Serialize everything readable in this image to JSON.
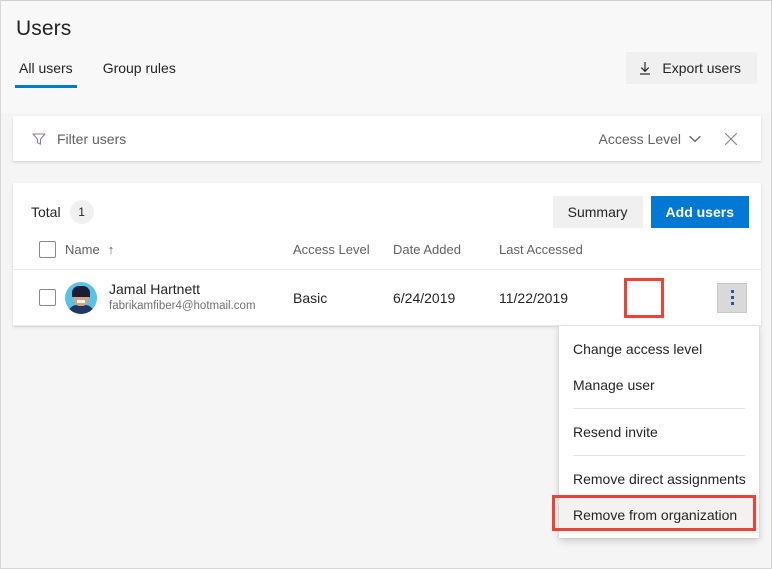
{
  "header": {
    "title": "Users",
    "tabs": [
      {
        "label": "All users",
        "active": true
      },
      {
        "label": "Group rules",
        "active": false
      }
    ],
    "export_button": {
      "label": "Export users",
      "icon": "download-icon"
    }
  },
  "filter_bar": {
    "icon": "filter-funnel-icon",
    "placeholder": "Filter users",
    "access_level_label": "Access Level",
    "chevron_icon": "chevron-down-icon",
    "clear_icon": "close-icon"
  },
  "toolbar": {
    "total_label": "Total",
    "total_count": "1",
    "summary_label": "Summary",
    "add_users_label": "Add users"
  },
  "table": {
    "columns": [
      {
        "key": "select",
        "label": ""
      },
      {
        "key": "name",
        "label": "Name",
        "sort_arrow": "↑"
      },
      {
        "key": "access_level",
        "label": "Access Level"
      },
      {
        "key": "date_added",
        "label": "Date Added"
      },
      {
        "key": "last_accessed",
        "label": "Last Accessed"
      },
      {
        "key": "actions",
        "label": ""
      }
    ],
    "rows": [
      {
        "name": "Jamal Hartnett",
        "email": "fabrikamfiber4@hotmail.com",
        "access_level": "Basic",
        "date_added": "6/24/2019",
        "last_accessed": "11/22/2019",
        "avatar": "user-avatar",
        "menu_icon": "kebab-more-icon"
      }
    ]
  },
  "context_menu": {
    "items": [
      {
        "label": "Change access level",
        "highlighted": false
      },
      {
        "label": "Manage user",
        "highlighted": false
      },
      {
        "divider": true
      },
      {
        "label": "Resend invite",
        "highlighted": false
      },
      {
        "divider": true
      },
      {
        "label": "Remove direct assignments",
        "highlighted": false
      },
      {
        "label": "Remove from organization",
        "highlighted": true
      }
    ]
  },
  "annotations": {
    "highlight_color": "#ec4237",
    "targets": [
      "kebab-more-icon",
      "Remove from organization"
    ]
  },
  "colors": {
    "accent": "#0078d4",
    "page_background": "#f5f5f5",
    "card_background": "#ffffff",
    "text_primary": "#242424",
    "text_secondary": "#616161",
    "highlight": "#ec4237"
  }
}
